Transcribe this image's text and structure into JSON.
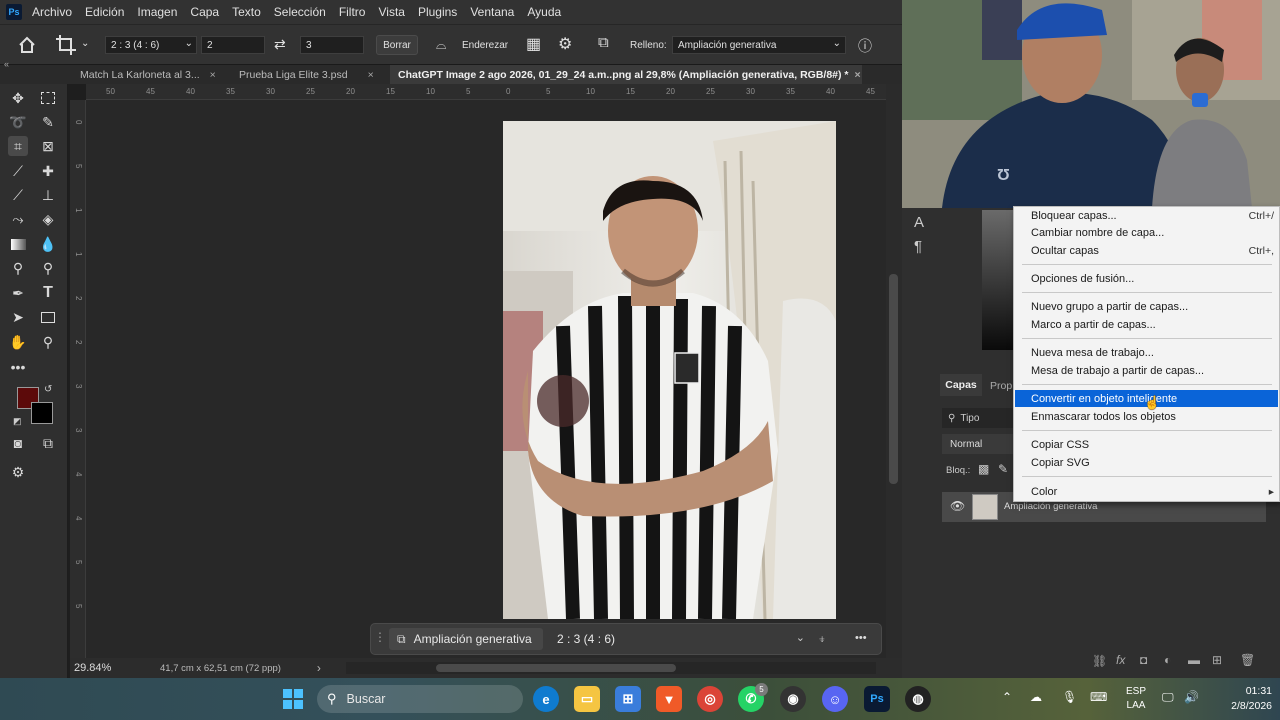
{
  "menubar": {
    "app_icon": "Ps",
    "items": [
      "Archivo",
      "Edición",
      "Imagen",
      "Capa",
      "Texto",
      "Selección",
      "Filtro",
      "Vista",
      "Plugins",
      "Ventana",
      "Ayuda"
    ]
  },
  "options": {
    "ratio": "2 : 3 (4 : 6)",
    "width": "2",
    "height": "3",
    "clear_label": "Borrar",
    "straighten_label": "Enderezar",
    "fill_label": "Relleno:",
    "fill_value": "Ampliación generativa"
  },
  "tabs": [
    {
      "label": "Match La Karloneta al 3...",
      "close": "×"
    },
    {
      "label": "Prueba Liga Elite 3.psd",
      "close": "×"
    },
    {
      "label": "ChatGPT Image 2 ago 2026, 01_29_24 a.m..png al 29,8% (Ampliación generativa, RGB/8#) *",
      "close": "×"
    }
  ],
  "ruler_top": [
    "50",
    "45",
    "40",
    "35",
    "30",
    "25",
    "20",
    "15",
    "10",
    "5",
    "0",
    "5",
    "10",
    "15",
    "20",
    "25",
    "30",
    "35",
    "40",
    "45"
  ],
  "ruler_left": [
    "0",
    "5",
    "1",
    "1",
    "2",
    "2",
    "3",
    "3",
    "4",
    "4",
    "5",
    "5"
  ],
  "status": {
    "zoom": "29.84%",
    "doc_size": "41,7 cm x 62,51 cm (72 ppp)",
    "arrow": "›"
  },
  "ctxbar": {
    "gen_label": "Ampliación generativa",
    "ratio": "2 : 3 (4 : 6)",
    "more": "•••"
  },
  "panels": {
    "layers_tab": "Capas",
    "props_tab": "Prop",
    "filter_label": "Tipo",
    "blend_mode": "Normal",
    "lock_label": "Bloq.:",
    "layer_name": "Ampliación generativa",
    "char_icon": "A",
    "para_icon": "¶"
  },
  "context_menu": {
    "items": [
      {
        "label": "Bloquear capas...",
        "shortcut": "Ctrl+/"
      },
      {
        "label": "Cambiar nombre de capa...",
        "shortcut": ""
      },
      {
        "label": "Ocultar capas",
        "shortcut": "Ctrl+,"
      },
      {
        "label": "Opciones de fusión...",
        "shortcut": ""
      },
      {
        "label": "Nuevo grupo a partir de capas...",
        "shortcut": ""
      },
      {
        "label": "Marco a partir de capas...",
        "shortcut": ""
      },
      {
        "label": "Nueva mesa de trabajo...",
        "shortcut": ""
      },
      {
        "label": "Mesa de trabajo a partir de capas...",
        "shortcut": ""
      },
      {
        "label": "Convertir en objeto inteligente",
        "shortcut": ""
      },
      {
        "label": "Enmascarar todos los objetos",
        "shortcut": ""
      },
      {
        "label": "Copiar CSS",
        "shortcut": ""
      },
      {
        "label": "Copiar SVG",
        "shortcut": ""
      },
      {
        "label": "Color",
        "shortcut": "▸"
      }
    ],
    "highlight_color": "#0a64d8"
  },
  "taskbar": {
    "search_label": "Buscar",
    "lang_top": "ESP",
    "lang_bottom": "LAA",
    "time": "01:31",
    "date": "2/8/2026",
    "whatsapp_badge": "5"
  },
  "colors": {
    "foreground": "#5c0a0a",
    "background": "#000000",
    "accent": "#31a8ff"
  }
}
